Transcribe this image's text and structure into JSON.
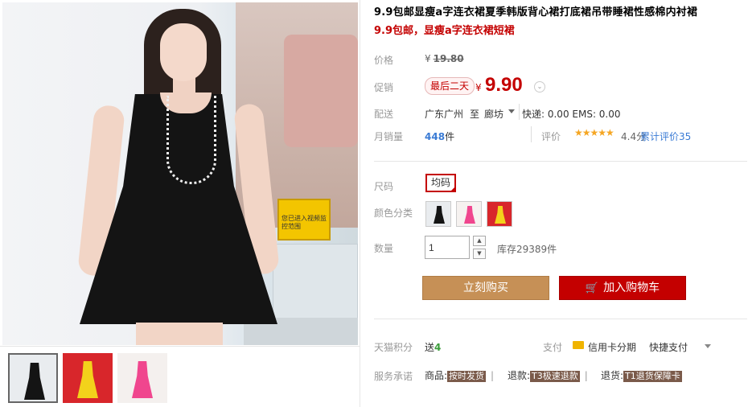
{
  "product": {
    "title": "9.9包邮显瘦a字连衣裙夏季韩版背心裙打底裙吊带睡裙性感棉内衬裙",
    "subtitle": "9.9包邮，显瘦a字连衣裙短裙"
  },
  "price": {
    "label": "价格",
    "currency": "¥",
    "original": "19.80"
  },
  "promo": {
    "label": "促销",
    "badge": "最后二天",
    "currency": "¥",
    "price": "9.90",
    "arrow": "⌄"
  },
  "shipping": {
    "label": "配送",
    "from": "广东广州",
    "to_word": "至",
    "to_city": "廊坊",
    "fees": "快递: 0.00 EMS: 0.00"
  },
  "sales": {
    "label": "月销量",
    "count": "448",
    "unit": "件",
    "review_label": "评价",
    "stars": "★★★★★",
    "rating_value": 4.4,
    "rating_text": "4.4分",
    "reviews_text": "累计评价35"
  },
  "size": {
    "label": "尺码",
    "option": "均码"
  },
  "color": {
    "label": "颜色分类",
    "swatches": [
      "black",
      "pink",
      "yellow"
    ]
  },
  "quantity": {
    "label": "数量",
    "value": "1",
    "up": "▲",
    "down": "▼",
    "stock": "库存29389件"
  },
  "buttons": {
    "buy": "立刻购买",
    "cart": "加入购物车",
    "cart_icon": "🛒"
  },
  "points": {
    "label": "天猫积分",
    "prefix": "送",
    "value": "4"
  },
  "payment": {
    "label": "支付",
    "credit": "信用卡分期",
    "quick": "快捷支付"
  },
  "promise": {
    "label": "服务承诺",
    "goods_prefix": "商品:",
    "goods_tag": "按时发货",
    "refund_prefix": "退款:",
    "refund_tag": "T3极速退款",
    "return_prefix": "退货:",
    "return_tag": "T1退货保障卡",
    "sep": "|"
  },
  "photo": {
    "sign_text": "您已进入视频监控范围"
  },
  "colors": {
    "accent_red": "#c40000",
    "buy_button": "#c69056",
    "link_blue": "#3a7bd5",
    "star": "#f5a623"
  }
}
